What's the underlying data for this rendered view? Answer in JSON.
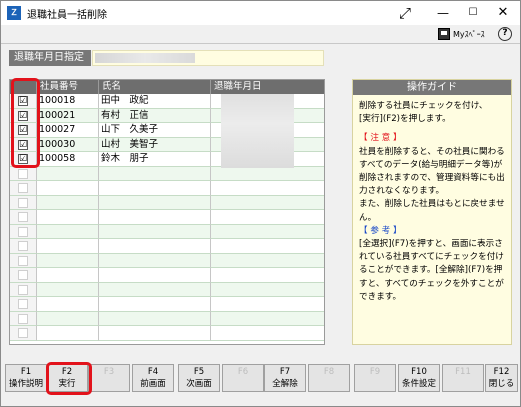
{
  "window": {
    "title": "退職社員一括削除"
  },
  "toolbar": {
    "myspace_label": "Myｽﾍﾟｰｽ"
  },
  "filter": {
    "label": "退職年月日指定"
  },
  "table": {
    "headers": {
      "check": "",
      "emp_no": "社員番号",
      "name": "氏名",
      "retire_date": "退職年月日"
    },
    "rows": [
      {
        "checked": "☑",
        "emp_no": "100018",
        "name": "田中　政紀"
      },
      {
        "checked": "☑",
        "emp_no": "100021",
        "name": "有村　正信"
      },
      {
        "checked": "☑",
        "emp_no": "100027",
        "name": "山下　久美子"
      },
      {
        "checked": "☑",
        "emp_no": "100030",
        "name": "山村　美智子"
      },
      {
        "checked": "☑",
        "emp_no": "100058",
        "name": "鈴木　朋子"
      }
    ]
  },
  "guide": {
    "title": "操作ガイド",
    "line1": "削除する社員にチェックを付け、",
    "line2": "[実行](F2)を押します。",
    "caution_title": "【 注 意 】",
    "caution_text": "社員を削除すると、その社員に関わるすべてのデータ(給与明細データ等)が削除されますので、管理資料等にも出力されなくなります。",
    "caution_text2": "また、削除した社員はもとに戻せません。",
    "ref_title": "【 参 考 】",
    "ref_text": "[全選択](F7)を押すと、画面に表示されている社員すべてにチェックを付けることができます。[全解除](F7)を押すと、すべてのチェックを外すことができます。"
  },
  "fkeys": [
    {
      "key": "F1",
      "label": "操作説明"
    },
    {
      "key": "F2",
      "label": "実行"
    },
    {
      "key": "F3",
      "label": ""
    },
    {
      "key": "F4",
      "label": "前画面"
    },
    {
      "key": "F5",
      "label": "次画面"
    },
    {
      "key": "F6",
      "label": ""
    },
    {
      "key": "F7",
      "label": "全解除"
    },
    {
      "key": "F8",
      "label": ""
    },
    {
      "key": "F9",
      "label": ""
    },
    {
      "key": "F10",
      "label": "条件設定"
    },
    {
      "key": "F11",
      "label": ""
    },
    {
      "key": "F12",
      "label": "閉じる"
    }
  ],
  "colors": {
    "highlight": "#e2121b",
    "guide_bg": "#fffde1",
    "header_bg": "#6e6e6e"
  }
}
